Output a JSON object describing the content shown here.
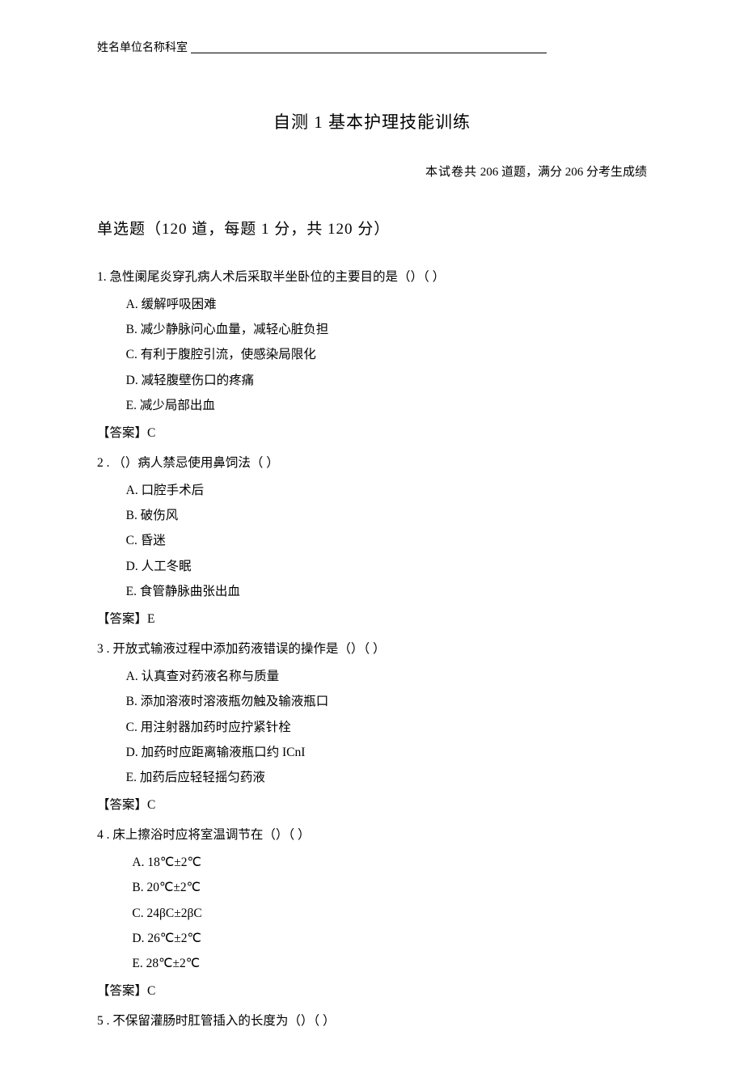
{
  "header": {
    "label": "姓名单位名称科室"
  },
  "title": "自测 1 基本护理技能训练",
  "subtitle": {
    "left": "本试卷共",
    "q_count": "206",
    "mid1": "道题，满分",
    "score_full": "206",
    "mid2": "分考生成绩"
  },
  "section": {
    "label": "单选题（120 道，每题 1 分，共 120 分）"
  },
  "questions": [
    {
      "num": "1.",
      "stem": "急性阑尾炎穿孔病人术后采取半坐卧位的主要目的是（）（            ）",
      "options": [
        "A. 缓解呼吸困难",
        "B. 减少静脉问心血量，减轻心脏负担",
        "C. 有利于腹腔引流，使感染局限化",
        "D. 减轻腹壁伤口的疼痛",
        "E. 减少局部出血"
      ],
      "answer_label": "【答案】",
      "answer": "C"
    },
    {
      "num": "2  .",
      "stem": "（）病人禁忌使用鼻饲法（        ）",
      "options": [
        "A. 口腔手术后",
        "B. 破伤风",
        "C. 昏迷",
        "D. 人工冬眠",
        "E. 食管静脉曲张出血"
      ],
      "answer_label": "【答案】",
      "answer": "E"
    },
    {
      "num": "3  .",
      "stem": "开放式输液过程中添加药液错误的操作是（）（        ）",
      "options": [
        "A. 认真查对药液名称与质量",
        "B. 添加溶液时溶液瓶勿触及输液瓶口",
        "C. 用注射器加药时应拧紧针栓",
        "D. 加药时应距离输液瓶口约 ICnI",
        "E. 加药后应轻轻摇匀药液"
      ],
      "answer_label": "【答案】",
      "answer": "C"
    },
    {
      "num": "4  .",
      "stem": "床上擦浴时应将室温调节在（）（        ）",
      "options": [
        "A.  18℃±2℃",
        "B.  20℃±2℃",
        "C.  24βC±2βC",
        "D.  26℃±2℃",
        "E.  28℃±2℃"
      ],
      "answer_label": "【答案】",
      "answer": "C"
    },
    {
      "num": "5  .",
      "stem": "不保留灌肠时肛管插入的长度为（）（        ）",
      "options": [],
      "answer_label": "",
      "answer": ""
    }
  ]
}
